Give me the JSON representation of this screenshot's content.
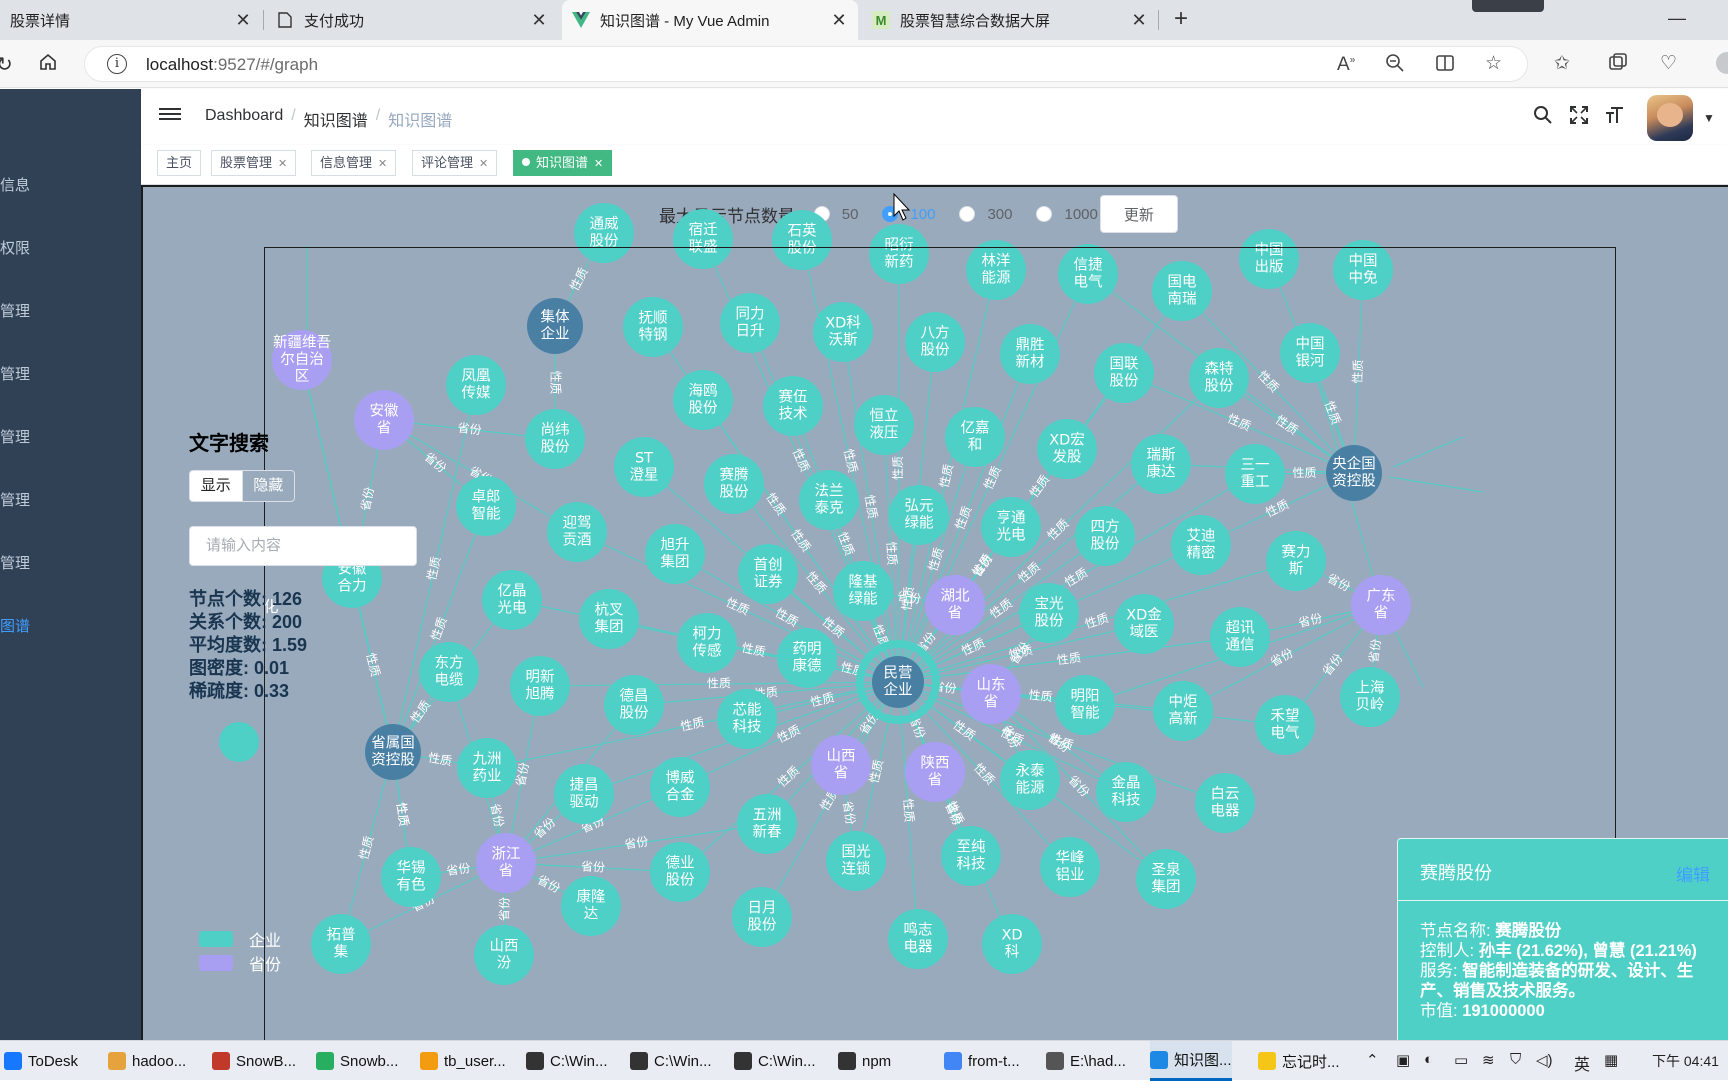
{
  "browser": {
    "tabs": [
      {
        "title": "股票详情",
        "icon": "page-icon"
      },
      {
        "title": "支付成功",
        "icon": "document-icon"
      },
      {
        "title": "知识图谱 - My Vue Admin",
        "icon": "vue-logo-icon"
      },
      {
        "title": "股票智慧综合数据大屏",
        "icon": "vue-m-icon"
      }
    ],
    "url_host": "localhost",
    "url_rest": ":9527/#/graph"
  },
  "sidebar": {
    "items": [
      "信息",
      "权限",
      "管理",
      "管理",
      "管理",
      "管理",
      "管理",
      "图谱"
    ]
  },
  "navbar": {
    "breadcrumb": [
      "Dashboard",
      "知识图谱",
      "知识图谱"
    ],
    "separator": "/"
  },
  "tags": [
    {
      "label": "主页",
      "closable": false
    },
    {
      "label": "股票管理",
      "closable": true
    },
    {
      "label": "信息管理",
      "closable": true
    },
    {
      "label": "评论管理",
      "closable": true
    },
    {
      "label": "知识图谱",
      "closable": true,
      "active": true
    }
  ],
  "graph_controls": {
    "label": "最大显示节点数量:",
    "options": [
      "50",
      "100",
      "300",
      "1000"
    ],
    "selected": "100",
    "update_label": "更新"
  },
  "search_panel": {
    "title": "文字搜索",
    "show_label": "显示",
    "hide_label": "隐藏",
    "placeholder": "请输入内容"
  },
  "stats": [
    {
      "label": "节点个数:",
      "value": "126"
    },
    {
      "label": "关系个数:",
      "value": "200"
    },
    {
      "label": "平均度数:",
      "value": "1.59"
    },
    {
      "label": "图密度:",
      "value": "0.01"
    },
    {
      "label": "稀疏度:",
      "value": "0.33"
    }
  ],
  "legend": [
    {
      "label": "企业",
      "color": "#4fd0c7"
    },
    {
      "label": "省份",
      "color": "#a99ff2"
    }
  ],
  "colors": {
    "company": "#4fd0c7",
    "province": "#a99ff2",
    "category": "#4a7fa4",
    "edge": "#4fd0c7",
    "background": "#98aabc"
  },
  "edge_labels": [
    "性质",
    "省份"
  ],
  "graph": {
    "nodes": [
      {
        "id": "n1",
        "label": "通威股份",
        "type": "company"
      },
      {
        "id": "n2",
        "label": "宿迁联盛",
        "type": "company"
      },
      {
        "id": "n3",
        "label": "石英股份",
        "type": "company"
      },
      {
        "id": "n4",
        "label": "昭衍新药",
        "type": "company"
      },
      {
        "id": "n5",
        "label": "林洋能源",
        "type": "company"
      },
      {
        "id": "n6",
        "label": "信捷电气",
        "type": "company"
      },
      {
        "id": "n7",
        "label": "中国出版",
        "type": "company"
      },
      {
        "id": "n8",
        "label": "中国中免",
        "type": "company"
      },
      {
        "id": "n9",
        "label": "新疆维吾尔自治区",
        "type": "province"
      },
      {
        "id": "n10",
        "label": "集体企业",
        "type": "category"
      },
      {
        "id": "n11",
        "label": "抚顺特钢",
        "type": "company"
      },
      {
        "id": "n12",
        "label": "同力日升",
        "type": "company"
      },
      {
        "id": "n13",
        "label": "XD科沃斯",
        "type": "company"
      },
      {
        "id": "n14",
        "label": "八方股份",
        "type": "company"
      },
      {
        "id": "n15",
        "label": "鼎胜新材",
        "type": "company"
      },
      {
        "id": "n16",
        "label": "国电南瑞",
        "type": "company"
      },
      {
        "id": "n17",
        "label": "中国银河",
        "type": "company"
      },
      {
        "id": "n18",
        "label": "安徽省",
        "type": "province"
      },
      {
        "id": "n19",
        "label": "凤凰传媒",
        "type": "company"
      },
      {
        "id": "n20",
        "label": "海鸥股份",
        "type": "company"
      },
      {
        "id": "n21",
        "label": "赛伍技术",
        "type": "company"
      },
      {
        "id": "n22",
        "label": "恒立液压",
        "type": "company"
      },
      {
        "id": "n23",
        "label": "国联股份",
        "type": "company"
      },
      {
        "id": "n24",
        "label": "森特股份",
        "type": "company"
      },
      {
        "id": "n25",
        "label": "尚纬股份",
        "type": "company"
      },
      {
        "id": "n26",
        "label": "ST澄星",
        "type": "company"
      },
      {
        "id": "n27",
        "label": "亿嘉和",
        "type": "company"
      },
      {
        "id": "n28",
        "label": "XD宏发股",
        "type": "company"
      },
      {
        "id": "n29",
        "label": "瑞斯康达",
        "type": "company"
      },
      {
        "id": "n30",
        "label": "三一重工",
        "type": "company"
      },
      {
        "id": "n31",
        "label": "央企国资控股",
        "type": "category"
      },
      {
        "id": "n32",
        "label": "卓郎智能",
        "type": "company"
      },
      {
        "id": "n33",
        "label": "赛腾股份",
        "type": "company"
      },
      {
        "id": "n34",
        "label": "法兰泰克",
        "type": "company"
      },
      {
        "id": "n35",
        "label": "弘元绿能",
        "type": "company"
      },
      {
        "id": "n36",
        "label": "亨通光电",
        "type": "company"
      },
      {
        "id": "n37",
        "label": "四方股份",
        "type": "company"
      },
      {
        "id": "n38",
        "label": "艾迪精密",
        "type": "company"
      },
      {
        "id": "n39",
        "label": "迎驾贡酒",
        "type": "company"
      },
      {
        "id": "n40",
        "label": "旭升集团",
        "type": "company"
      },
      {
        "id": "n41",
        "label": "首创证券",
        "type": "company"
      },
      {
        "id": "n42",
        "label": "隆基绿能",
        "type": "company"
      },
      {
        "id": "n43",
        "label": "湖北省",
        "type": "province"
      },
      {
        "id": "n44",
        "label": "宝光股份",
        "type": "company"
      },
      {
        "id": "n45",
        "label": "XD金域医",
        "type": "company"
      },
      {
        "id": "n46",
        "label": "赛力斯",
        "type": "company"
      },
      {
        "id": "n47",
        "label": "广东省",
        "type": "province"
      },
      {
        "id": "n48",
        "label": "安徽合力",
        "type": "company"
      },
      {
        "id": "n49",
        "label": "亿晶光电",
        "type": "company"
      },
      {
        "id": "n50",
        "label": "杭叉集团",
        "type": "company"
      },
      {
        "id": "n51",
        "label": "柯力传感",
        "type": "company"
      },
      {
        "id": "n52",
        "label": "药明康德",
        "type": "company"
      },
      {
        "id": "n53",
        "label": "民营企业",
        "type": "category"
      },
      {
        "id": "n54",
        "label": "山东省",
        "type": "province"
      },
      {
        "id": "n55",
        "label": "明阳智能",
        "type": "company"
      },
      {
        "id": "n56",
        "label": "超讯通信",
        "type": "company"
      },
      {
        "id": "n57",
        "label": "上海贝岭",
        "type": "company"
      },
      {
        "id": "n58",
        "label": "东方电缆",
        "type": "company"
      },
      {
        "id": "n59",
        "label": "明新旭腾",
        "type": "company"
      },
      {
        "id": "n60",
        "label": "德昌股份",
        "type": "company"
      },
      {
        "id": "n61",
        "label": "芯能科技",
        "type": "company"
      },
      {
        "id": "n62",
        "label": "山西省",
        "type": "province"
      },
      {
        "id": "n63",
        "label": "陕西省",
        "type": "province"
      },
      {
        "id": "n64",
        "label": "中炬高新",
        "type": "company"
      },
      {
        "id": "n65",
        "label": "禾望电气",
        "type": "company"
      },
      {
        "id": "n66",
        "label": "省属国资控股",
        "type": "category"
      },
      {
        "id": "n67",
        "label": "九洲药业",
        "type": "company"
      },
      {
        "id": "n68",
        "label": "捷昌驱动",
        "type": "company"
      },
      {
        "id": "n69",
        "label": "博威合金",
        "type": "company"
      },
      {
        "id": "n70",
        "label": "五洲新春",
        "type": "company"
      },
      {
        "id": "n71",
        "label": "永泰能源",
        "type": "company"
      },
      {
        "id": "n72",
        "label": "金晶科技",
        "type": "company"
      },
      {
        "id": "n73",
        "label": "白云电器",
        "type": "company"
      },
      {
        "id": "n74",
        "label": "华锡有色",
        "type": "company"
      },
      {
        "id": "n75",
        "label": "浙江省",
        "type": "province"
      },
      {
        "id": "n76",
        "label": "康隆达",
        "type": "company"
      },
      {
        "id": "n77",
        "label": "德业股份",
        "type": "company"
      },
      {
        "id": "n78",
        "label": "国光连锁",
        "type": "company"
      },
      {
        "id": "n79",
        "label": "至纯科技",
        "type": "company"
      },
      {
        "id": "n80",
        "label": "华峰铝业",
        "type": "company"
      },
      {
        "id": "n81",
        "label": "圣泉集团",
        "type": "company"
      },
      {
        "id": "n82",
        "label": "日月股份",
        "type": "company"
      },
      {
        "id": "n83",
        "label": "拓普集",
        "type": "company"
      },
      {
        "id": "n84",
        "label": "鸣志电器",
        "type": "company"
      },
      {
        "id": "n85",
        "label": "XD科",
        "type": "company"
      },
      {
        "id": "n86",
        "label": "山西汾",
        "type": "company"
      }
    ],
    "visible_fragment": "化"
  },
  "detail": {
    "title": "赛腾股份",
    "edit_label": "编辑",
    "name_label": "节点名称:",
    "name_value": "赛腾股份",
    "controller_label": "控制人:",
    "controller_value": "孙丰 (21.62%), 曾慧 (21.21%)",
    "service_label": "服务:",
    "service_value": "智能制造装备的研发、设计、生产、销售及技术服务。",
    "market_value_label": "市值:",
    "market_value_value": "191000000"
  },
  "taskbar": {
    "items": [
      "ToDesk",
      "hadoo...",
      "SnowB...",
      "Snowb...",
      "tb_user...",
      "C:\\Win...",
      "C:\\Win...",
      "C:\\Win...",
      "npm",
      "from-t...",
      "E:\\had...",
      "知识图...",
      "忘记时..."
    ],
    "ime": "英",
    "time": "下午 04:41"
  }
}
